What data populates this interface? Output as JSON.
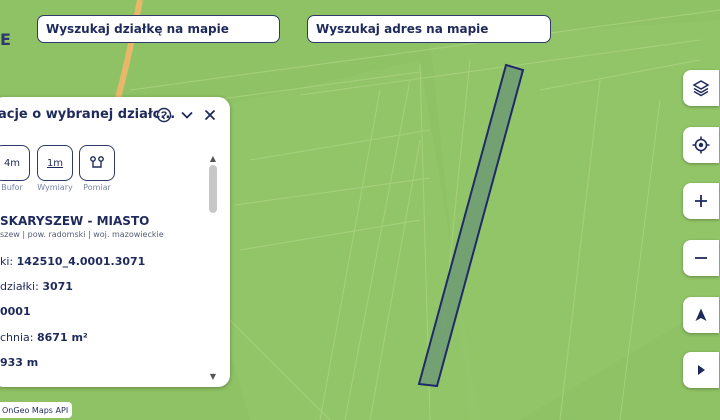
{
  "brand": {
    "letter": "E"
  },
  "search": {
    "parcel_label": "Wyszukaj działkę na mapie",
    "address_label": "Wyszukaj adres na mapie"
  },
  "panel": {
    "title": "acje o wybranej działc...",
    "tools": [
      {
        "icon_text": "4m",
        "label": "Bufor"
      },
      {
        "icon_text": "1m",
        "label": "Wymiary"
      },
      {
        "icon_text": "",
        "label": "Pomiar"
      }
    ],
    "municipality": "SKARYSZEW - MIASTO",
    "location": "szew | pow. radomski | woj. mazowieckie",
    "parcel_id_label": "ki:",
    "parcel_id_value": "142510_4.0001.3071",
    "parcel_no_label": "działki:",
    "parcel_no_value": "3071",
    "precinct_value": "0001",
    "area_label": "chnia:",
    "area_value": "8671 m²",
    "length_value": "933 m"
  },
  "map_icons": [
    "layers-icon",
    "locate-icon",
    "zoom-in-icon",
    "zoom-out-icon",
    "north-arrow-icon",
    "expand-right-icon"
  ],
  "attribution": "OnGeo Maps API",
  "colors": {
    "map_green": "#8cc063",
    "parcel_fill": "#6e9a74",
    "parcel_stroke": "#1f2a6b",
    "road": "#e8b86a",
    "ui_text": "#1f2a5c"
  }
}
